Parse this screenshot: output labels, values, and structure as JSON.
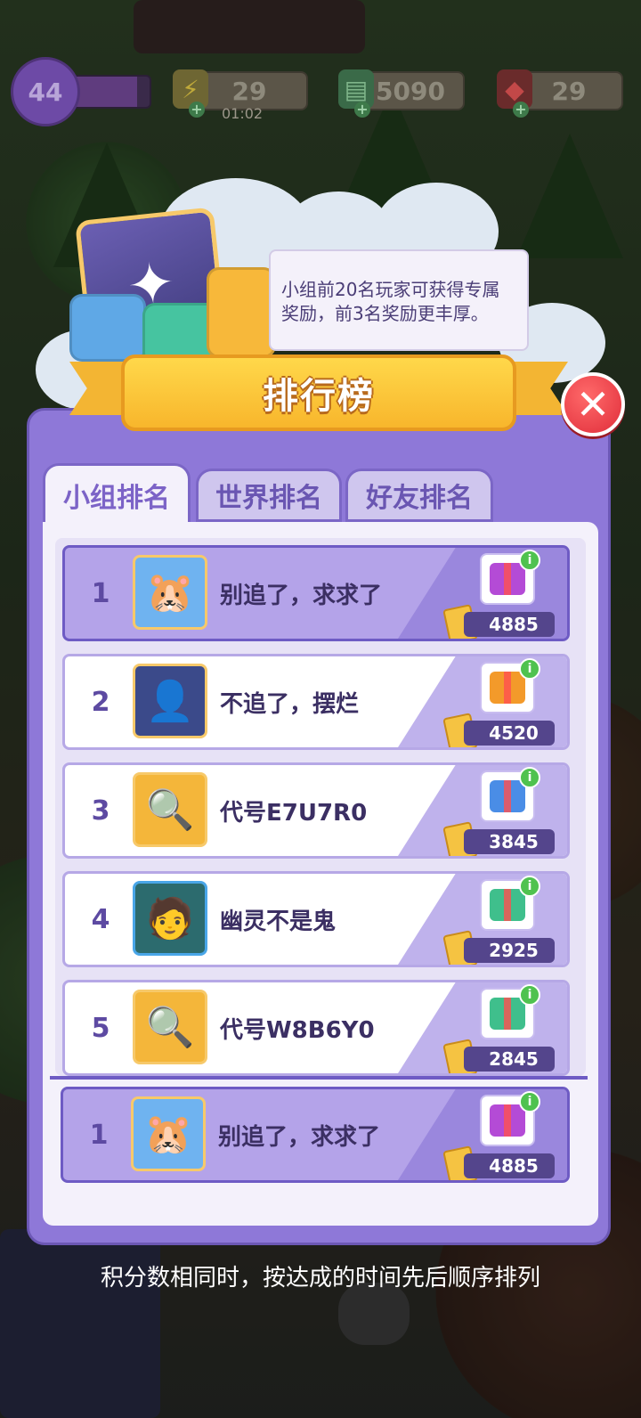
{
  "hud": {
    "level": "44",
    "level_progress": 0.85,
    "energy": "29",
    "energy_timer": "01:02",
    "cash": "5090",
    "gems": "29",
    "icons": {
      "energy": "lightning-icon",
      "cash": "cash-stack-icon",
      "gems": "ruby-icon"
    }
  },
  "header": {
    "reward_tip": "小组前20名玩家可获得专属奖励，前3名奖励更丰厚。",
    "title": "排行榜"
  },
  "tabs": [
    {
      "label": "小组排名",
      "active": true
    },
    {
      "label": "世界排名",
      "active": false
    },
    {
      "label": "好友排名",
      "active": false
    }
  ],
  "leaderboard": [
    {
      "rank": "1",
      "name": "别追了，求求了",
      "score": "4885",
      "gift_color": "#b44bd6",
      "avatar": "hamster-avatar",
      "highlight": true
    },
    {
      "rank": "2",
      "name": "不追了，摆烂",
      "score": "4520",
      "gift_color": "#f39a2a",
      "avatar": "hooded-avatar",
      "highlight": false
    },
    {
      "rank": "3",
      "name": "代号E7U7R0",
      "score": "3845",
      "gift_color": "#4a8de6",
      "avatar": "detective-avatar",
      "highlight": false
    },
    {
      "rank": "4",
      "name": "幽灵不是鬼",
      "score": "2925",
      "gift_color": "#3fbf8c",
      "avatar": "green-hair-avatar",
      "highlight": false
    },
    {
      "rank": "5",
      "name": "代号W8B6Y0",
      "score": "2845",
      "gift_color": "#3fbf8c",
      "avatar": "detective-avatar",
      "highlight": false
    }
  ],
  "my_rank": {
    "rank": "1",
    "name": "别追了，求求了",
    "score": "4885",
    "gift_color": "#b44bd6"
  },
  "footer_note": "积分数相同时，按达成的时间先后顺序排列",
  "colors": {
    "panel": "#8e78d8",
    "ribbon": "#f8b62c",
    "close": "#e02d3a",
    "info": "#4fc24f"
  }
}
